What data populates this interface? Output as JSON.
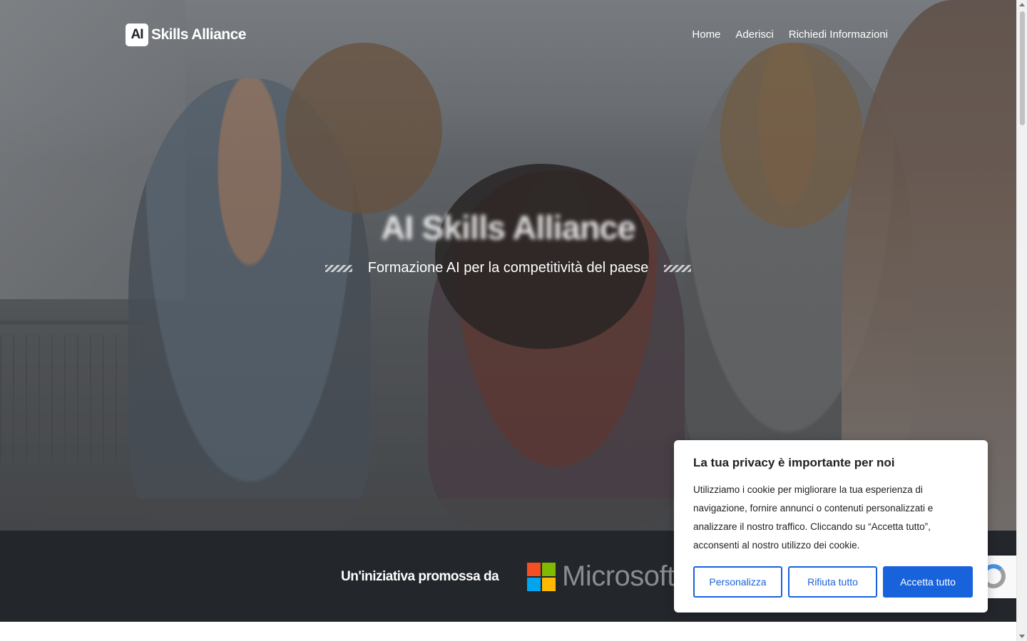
{
  "header": {
    "logo_badge": "AI",
    "logo_text": "Skills Alliance",
    "nav": [
      {
        "label": "Home"
      },
      {
        "label": "Aderisci"
      },
      {
        "label": "Richiedi Informazioni"
      }
    ]
  },
  "hero": {
    "title": "AI Skills Alliance",
    "subtitle": "Formazione AI per la competitività del paese"
  },
  "sponsor": {
    "label": "Un'iniziativa promossa da",
    "brand": "Microsoft",
    "brand_colors": [
      "#f25022",
      "#7fba00",
      "#00a4ef",
      "#ffb900"
    ]
  },
  "cookie_banner": {
    "title": "La tua privacy è importante per noi",
    "body": "Utilizziamo i cookie per migliorare la tua esperienza di navigazione, fornire annunci o contenuti personalizzati e analizzare il nostro traffico. Cliccando su “Accetta tutto”, acconsenti al nostro utilizzo dei cookie.",
    "buttons": {
      "customize": "Personalizza",
      "reject": "Rifiuta tutto",
      "accept": "Accetta tutto"
    },
    "accent_color": "#1863dc"
  }
}
